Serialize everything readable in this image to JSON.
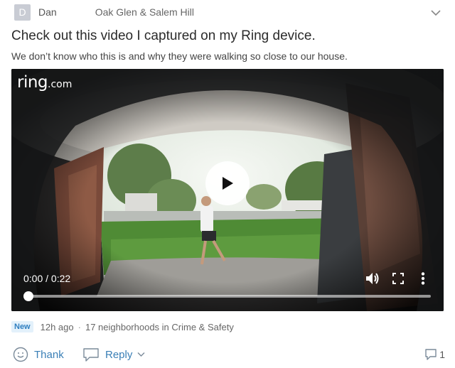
{
  "post": {
    "author_initial": "D",
    "author": "Dan",
    "neighborhood": "Oak Glen & Salem Hill",
    "title": "Check out this video I captured on my Ring device.",
    "body": "We don’t know who this is and why they were walking so close to our house."
  },
  "video": {
    "logo_main": "ring",
    "logo_suffix": ".com",
    "time_display": "0:00 / 0:22",
    "progress": 0
  },
  "meta": {
    "badge": "New",
    "posted": "12h ago",
    "separator": "·",
    "scope": "17 neighborhoods in Crime & Safety"
  },
  "actions": {
    "thank": "Thank",
    "reply": "Reply",
    "reply_count": "1"
  },
  "icons": {
    "header_menu": "chevron-down-icon",
    "play": "play-icon",
    "volume": "volume-icon",
    "fullscreen": "fullscreen-icon",
    "more": "more-vertical-icon",
    "thank": "smile-icon",
    "reply": "speech-bubble-icon",
    "reply_dropdown": "chevron-down-icon",
    "comments": "comment-icon"
  },
  "colors": {
    "link": "#3a7fb6",
    "badge_bg": "#e3f1fb",
    "badge_text": "#2f7fc0",
    "avatar_bg": "#c9ccd4"
  }
}
